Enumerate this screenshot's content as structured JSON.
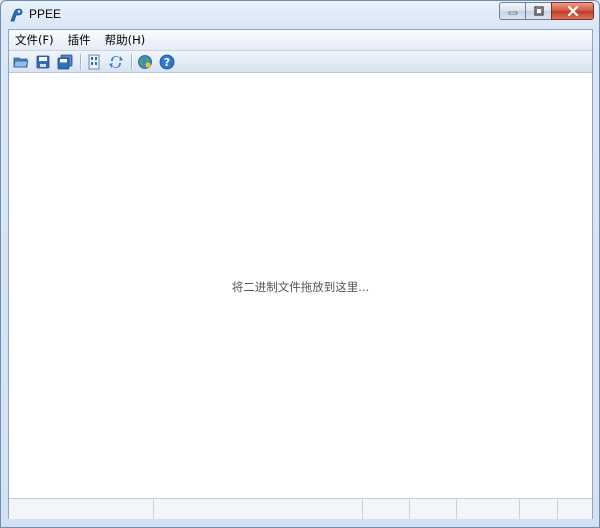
{
  "window": {
    "title": "PPEE",
    "accent": "#6f8fb2",
    "close_color": "#c13a24"
  },
  "titlebar_buttons": [
    {
      "name": "minimize-icon"
    },
    {
      "name": "maximize-icon"
    },
    {
      "name": "close-icon"
    }
  ],
  "menu": {
    "items": [
      "文件(F)",
      "插件",
      "帮助(H)"
    ]
  },
  "toolbar": {
    "buttons": [
      "open-folder-icon",
      "save-icon",
      "save-all-icon",
      "binary-view-icon",
      "refresh-icon",
      "globe-icon",
      "help-icon"
    ]
  },
  "content": {
    "drop_hint": "将二进制文件拖放到这里..."
  },
  "status_bar": {
    "panes": [
      "",
      "",
      "",
      "",
      "",
      "",
      ""
    ]
  }
}
